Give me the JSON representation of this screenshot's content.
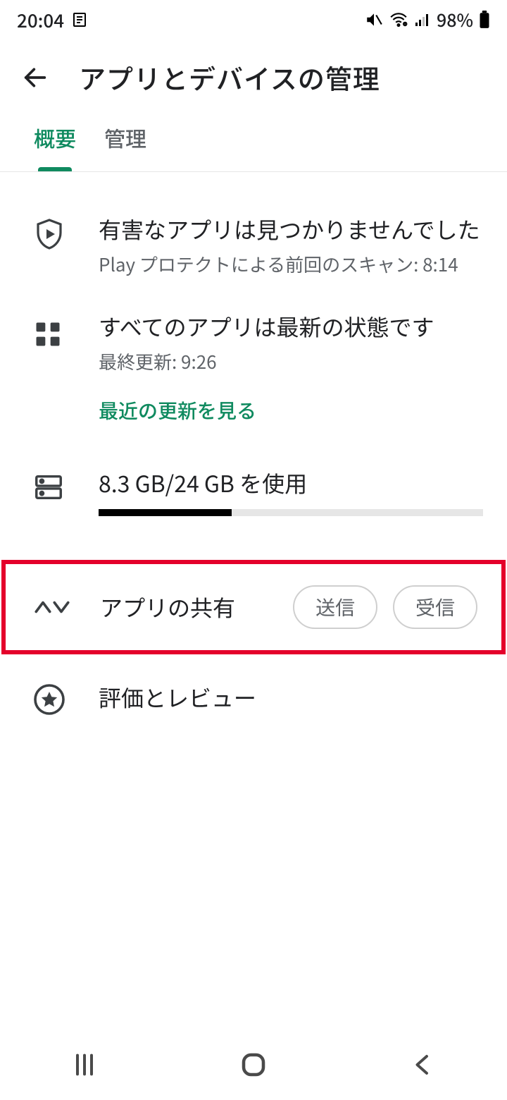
{
  "status": {
    "time": "20:04",
    "battery_pct": "98%"
  },
  "header": {
    "title": "アプリとデバイスの管理"
  },
  "tabs": {
    "overview": "概要",
    "manage": "管理",
    "active": "overview"
  },
  "protect": {
    "title": "有害なアプリは見つかりませんでした",
    "subtitle": "Play プロテクトによる前回のスキャン: 8:14"
  },
  "updates": {
    "title": "すべてのアプリは最新の状態です",
    "subtitle": "最終更新: 9:26",
    "link": "最近の更新を見る"
  },
  "storage": {
    "label": "8.3 GB/24 GB を使用",
    "used": 8.3,
    "total": 24
  },
  "share": {
    "title": "アプリの共有",
    "send": "送信",
    "receive": "受信"
  },
  "reviews": {
    "title": "評価とレビュー"
  }
}
